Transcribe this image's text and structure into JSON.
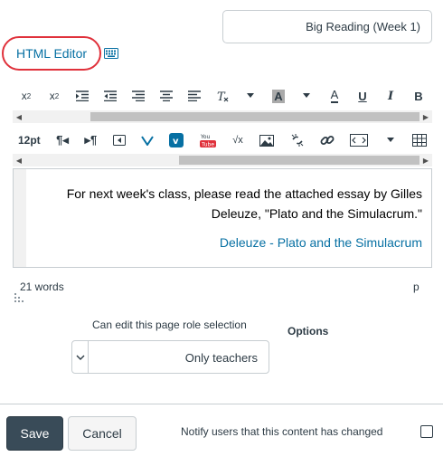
{
  "title_field": {
    "value": "Big Reading (Week 1)"
  },
  "editor_toggle": {
    "label": "HTML Editor"
  },
  "toolbar_row1": {
    "bold": "B",
    "italic": "I",
    "underline": "U",
    "text_color": "A",
    "background_color": "A",
    "superscript": "x",
    "subscript": "x"
  },
  "toolbar_row2": {
    "font_size": "12pt"
  },
  "content": {
    "paragraph": "For next week's class, please read the attached essay by Gilles Deleuze, \"Plato and the Simulacrum.\"",
    "link_text": "Deleuze - Plato and the Simulacrum"
  },
  "status": {
    "path": "p",
    "word_count": "21 words"
  },
  "options": {
    "label": "Options",
    "role_label": "Can edit this page role selection",
    "role_value": "Only teachers"
  },
  "footer": {
    "save_label": "Save",
    "cancel_label": "Cancel",
    "notify_label": "Notify users that this content has changed"
  },
  "colors": {
    "link": "#0770a3",
    "highlight_ring": "#e0313b",
    "save_bg": "#394b58"
  }
}
